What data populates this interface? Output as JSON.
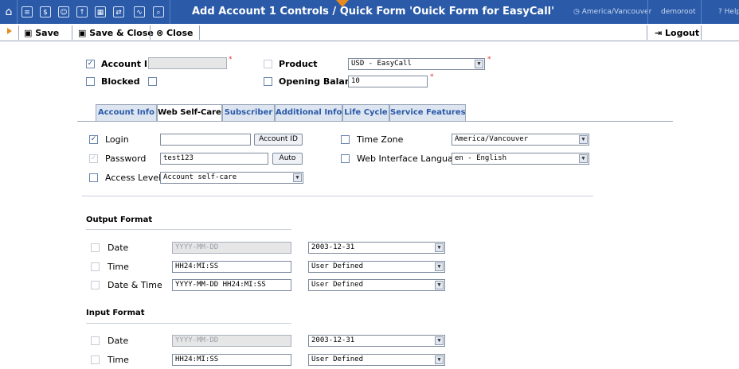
{
  "topbar": {
    "title": "Add Account 1 Controls / Quick Form 'Ouick Form for EasyCall'",
    "timezone": "America/Vancouver",
    "user": "demoroot",
    "help": "Help",
    "icons": [
      "home-icon",
      "list-icon",
      "dollar-icon",
      "users-icon",
      "upload-icon",
      "grid-icon",
      "transfer-icon",
      "chart-icon",
      "search-icon"
    ]
  },
  "toolbar": {
    "save": "Save",
    "save_close": "Save & Close",
    "close": "Close",
    "logout": "Logout"
  },
  "header": {
    "account_id_label": "Account ID",
    "account_id_value": "",
    "blocked_label": "Blocked",
    "product_label": "Product",
    "product_value": "USD - EasyCall",
    "opening_balance_label": "Opening Balance",
    "opening_balance_value": "10"
  },
  "tabs": [
    {
      "label": "Account Info"
    },
    {
      "label": "Web Self-Care"
    },
    {
      "label": "Subscriber"
    },
    {
      "label": "Additional Info"
    },
    {
      "label": "Life Cycle"
    },
    {
      "label": "Service Features"
    }
  ],
  "wsc": {
    "login_label": "Login",
    "login_value": "",
    "account_id_button": "Account ID",
    "password_label": "Password",
    "password_value": "test123",
    "auto_button": "Auto",
    "access_level_label": "Access Level",
    "access_level_value": "Account self-care",
    "time_zone_label": "Time Zone",
    "time_zone_value": "America/Vancouver",
    "web_lang_label": "Web Interface Language",
    "web_lang_value": "en - English"
  },
  "output_format": {
    "heading": "Output Format",
    "rows": [
      {
        "label": "Date",
        "pattern": "YYYY-MM-DD",
        "select": "2003-12-31"
      },
      {
        "label": "Time",
        "pattern": "HH24:MI:SS",
        "select": "User Defined"
      },
      {
        "label": "Date & Time",
        "pattern": "YYYY-MM-DD HH24:MI:SS",
        "select": "User Defined"
      }
    ]
  },
  "input_format": {
    "heading": "Input Format",
    "rows": [
      {
        "label": "Date",
        "pattern": "YYYY-MM-DD",
        "select": "2003-12-31"
      },
      {
        "label": "Time",
        "pattern": "HH24:MI:SS",
        "select": "User Defined"
      }
    ]
  },
  "colors": {
    "topbar": "#2a5aa8",
    "accent": "#e58a1f",
    "link": "#2a5aa8"
  }
}
